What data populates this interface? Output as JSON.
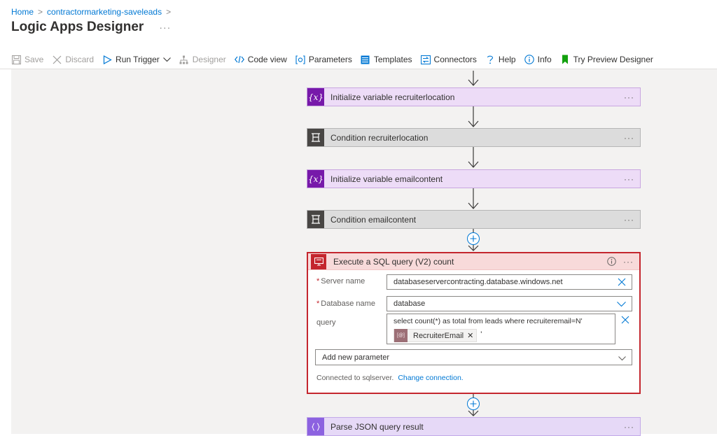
{
  "breadcrumb": {
    "home": "Home",
    "resource": "contractormarketing-saveleads",
    "separator": ">"
  },
  "page": {
    "title": "Logic Apps Designer",
    "more": "···"
  },
  "toolbar": {
    "save": "Save",
    "discard": "Discard",
    "run_trigger": "Run Trigger",
    "designer": "Designer",
    "code_view": "Code view",
    "parameters": "Parameters",
    "templates": "Templates",
    "connectors": "Connectors",
    "help": "Help",
    "info": "Info",
    "try_preview": "Try Preview Designer"
  },
  "steps": [
    {
      "title": "Initialize variable recruiterlocation",
      "kind": "variable",
      "icon": "variable-icon",
      "more": "···"
    },
    {
      "title": "Condition recruiterlocation",
      "kind": "condition",
      "icon": "condition-icon",
      "more": "···"
    },
    {
      "title": "Initialize variable emailcontent",
      "kind": "variable",
      "icon": "variable-icon",
      "more": "···"
    },
    {
      "title": "Condition emailcontent",
      "kind": "condition",
      "icon": "condition-icon",
      "more": "···"
    },
    {
      "title": "Parse JSON query result",
      "kind": "parse-json",
      "icon": "parse-json-icon",
      "more": "···"
    }
  ],
  "sql_step": {
    "title": "Execute a SQL query (V2) count",
    "more": "···",
    "server_label": "Server name",
    "server_value": "databaseservercontracting.database.windows.net",
    "database_label": "Database name",
    "database_value": "database",
    "query_label": "query",
    "query_text": "select count(*) as total from leads where recruiteremail=N'",
    "token_label": "RecruiterEmail",
    "token_after": "'",
    "add_param_placeholder": "Add new parameter",
    "connected_text": "Connected to sqlserver.",
    "change_connection": "Change connection."
  },
  "icons": {
    "variable_symbol": "{x}",
    "token_symbol": "[@]"
  },
  "colors": {
    "accent": "#0078d4",
    "variable": "#7719aa",
    "condition": "#484644",
    "sql": "#c4262e",
    "parse_json": "#8c62e0",
    "token": "#9c6f76"
  }
}
